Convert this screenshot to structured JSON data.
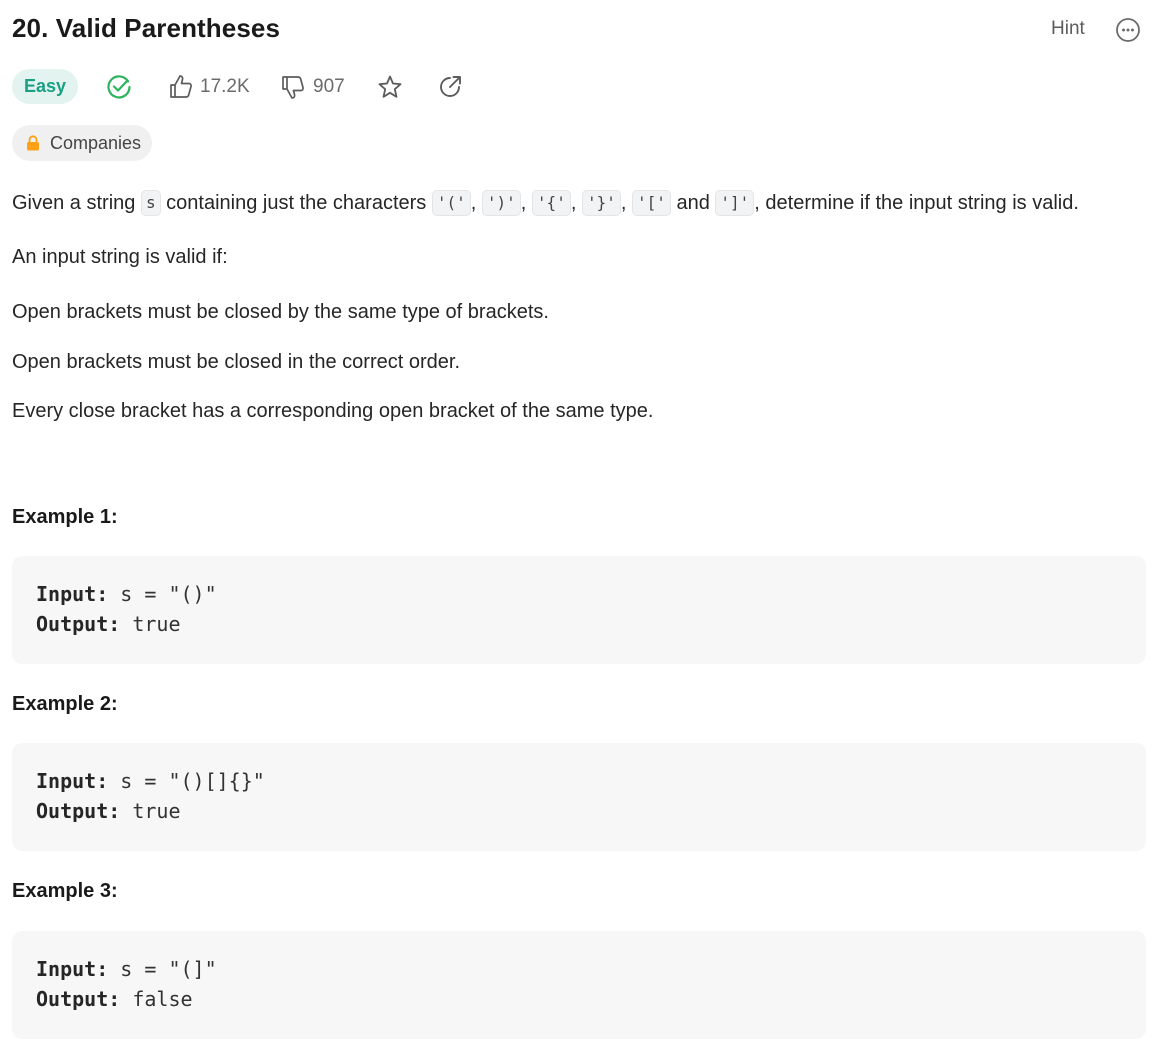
{
  "header": {
    "title": "20. Valid Parentheses",
    "hint_label": "Hint"
  },
  "meta": {
    "difficulty": "Easy",
    "likes": "17.2K",
    "dislikes": "907",
    "companies_label": "Companies"
  },
  "colors": {
    "easy_bg": "#e3f3ef",
    "easy_text": "#1ca085",
    "solved_check": "#2db55d",
    "lock": "#ffa116",
    "code_bg": "#f7f7f8"
  },
  "icons": [
    "solved-check-icon",
    "thumbs-up-icon",
    "thumbs-down-icon",
    "star-icon",
    "share-icon",
    "more-icon",
    "lock-icon"
  ],
  "description": {
    "intro_prefix": "Given a string ",
    "intro_var": "s",
    "intro_mid": " containing just the characters ",
    "chars": [
      "'('",
      "')'",
      "'{'",
      "'}'",
      "'['",
      "']'"
    ],
    "comma": ",",
    "and_word": "and",
    "intro_suffix": ", determine if the input string is valid.",
    "valid_if": "An input string is valid if:",
    "rules": [
      "Open brackets must be closed by the same type of brackets.",
      "Open brackets must be closed in the correct order.",
      "Every close bracket has a corresponding open bracket of the same type."
    ]
  },
  "examples": [
    {
      "title": "Example 1:",
      "input_label": "Input:",
      "input_value": "s = \"()\"",
      "output_label": "Output:",
      "output_value": "true"
    },
    {
      "title": "Example 2:",
      "input_label": "Input:",
      "input_value": "s = \"()[]{}\"",
      "output_label": "Output:",
      "output_value": "true"
    },
    {
      "title": "Example 3:",
      "input_label": "Input:",
      "input_value": "s = \"(]\"",
      "output_label": "Output:",
      "output_value": "false"
    }
  ]
}
